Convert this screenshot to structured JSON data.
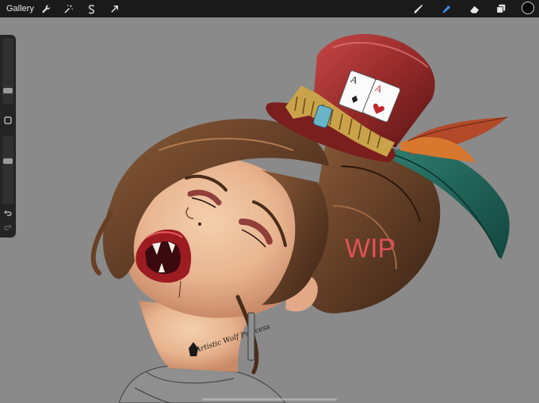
{
  "toolbar": {
    "gallery_label": "Gallery",
    "left_tools": [
      "wrench-icon",
      "magic-wand-icon",
      "selection-icon",
      "transform-arrow-icon"
    ],
    "right_tools": [
      "brush-icon",
      "smudge-icon",
      "eraser-icon",
      "layers-icon"
    ],
    "active_tool": "smudge-icon",
    "active_color": "#000000",
    "active_tool_color": "#3d8cf0"
  },
  "sidebar": {
    "brush_size_level": 0.4,
    "opacity_level": 0.45,
    "buttons": [
      "modify-square-icon",
      "undo-icon",
      "redo-icon"
    ]
  },
  "canvas": {
    "background": "#8a8a8a",
    "artwork_text": "WIP",
    "signature_text": "Artistic Wolf Princess",
    "card_text": "A"
  }
}
